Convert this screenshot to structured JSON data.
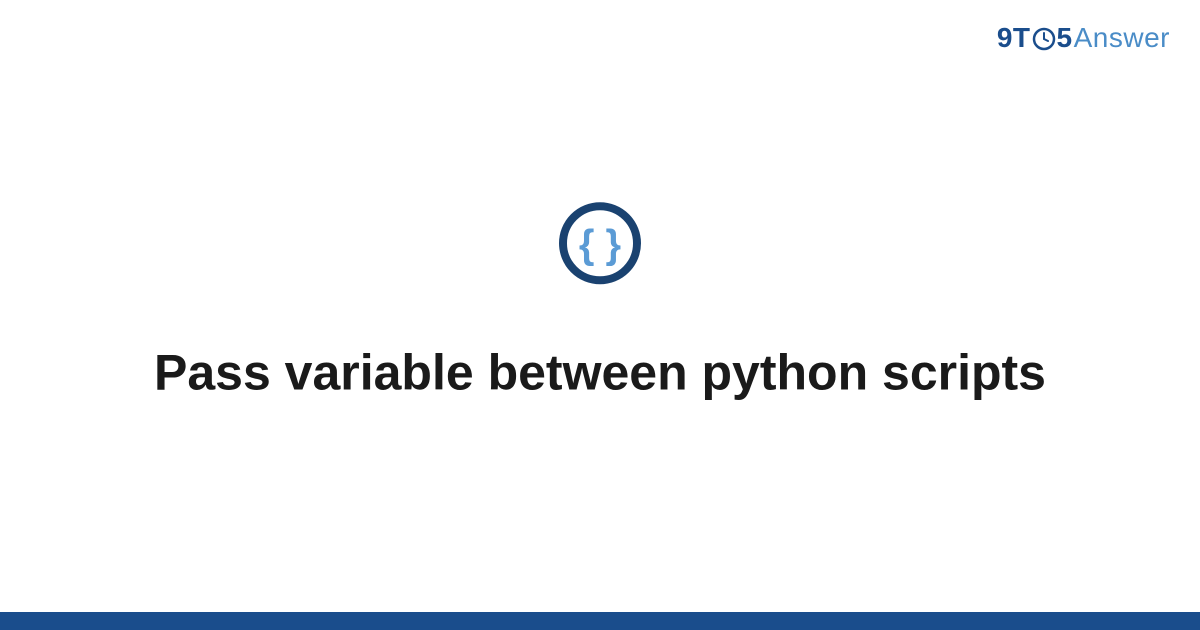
{
  "logo": {
    "part1": "9T",
    "part2": "5",
    "part3": "Answer"
  },
  "title": "Pass variable between python scripts",
  "colors": {
    "dark_blue": "#1a4d8c",
    "light_blue": "#4a8cc7",
    "text": "#1a1a1a"
  }
}
